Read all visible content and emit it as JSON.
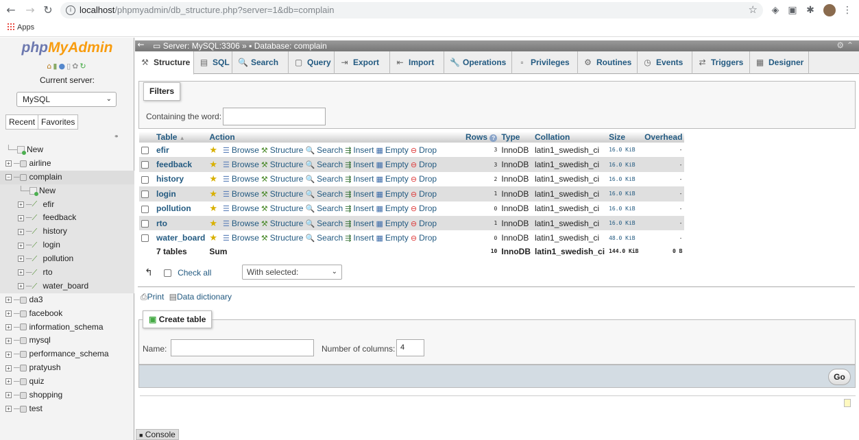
{
  "browser": {
    "url_host": "localhost",
    "url_path": "/phpmyadmin/db_structure.php?server=1&db=complain",
    "apps_label": "Apps"
  },
  "sidebar": {
    "logo_php": "php",
    "logo_myadmin": "MyAdmin",
    "current_server_label": "Current server:",
    "server_select": "MySQL",
    "tabs": [
      "Recent",
      "Favorites"
    ],
    "tree": [
      {
        "label": "New",
        "level": 0,
        "kind": "new"
      },
      {
        "label": "airline",
        "level": 0,
        "kind": "db"
      },
      {
        "label": "complain",
        "level": 0,
        "kind": "db",
        "expanded": true
      },
      {
        "label": "New",
        "level": 1,
        "kind": "new"
      },
      {
        "label": "efir",
        "level": 1,
        "kind": "table"
      },
      {
        "label": "feedback",
        "level": 1,
        "kind": "table"
      },
      {
        "label": "history",
        "level": 1,
        "kind": "table"
      },
      {
        "label": "login",
        "level": 1,
        "kind": "table"
      },
      {
        "label": "pollution",
        "level": 1,
        "kind": "table"
      },
      {
        "label": "rto",
        "level": 1,
        "kind": "table"
      },
      {
        "label": "water_board",
        "level": 1,
        "kind": "table"
      },
      {
        "label": "da3",
        "level": 0,
        "kind": "db"
      },
      {
        "label": "facebook",
        "level": 0,
        "kind": "db"
      },
      {
        "label": "information_schema",
        "level": 0,
        "kind": "db"
      },
      {
        "label": "mysql",
        "level": 0,
        "kind": "db"
      },
      {
        "label": "performance_schema",
        "level": 0,
        "kind": "db"
      },
      {
        "label": "pratyush",
        "level": 0,
        "kind": "db"
      },
      {
        "label": "quiz",
        "level": 0,
        "kind": "db"
      },
      {
        "label": "shopping",
        "level": 0,
        "kind": "db"
      },
      {
        "label": "test",
        "level": 0,
        "kind": "db"
      }
    ]
  },
  "breadcrumb": {
    "server": "Server: MySQL:3306",
    "sep": "»",
    "database": "Database: complain"
  },
  "menu": {
    "tabs": [
      {
        "label": "Structure",
        "icon": "structure-icon",
        "glyph": "⚒"
      },
      {
        "label": "SQL",
        "icon": "sql-icon",
        "glyph": "▤"
      },
      {
        "label": "Search",
        "icon": "search-icon",
        "glyph": "🔍"
      },
      {
        "label": "Query",
        "icon": "query-icon",
        "glyph": "▢"
      },
      {
        "label": "Export",
        "icon": "export-icon",
        "glyph": "⇥"
      },
      {
        "label": "Import",
        "icon": "import-icon",
        "glyph": "⇤"
      },
      {
        "label": "Operations",
        "icon": "wrench-icon",
        "glyph": "🔧"
      },
      {
        "label": "Privileges",
        "icon": "privileges-icon",
        "glyph": "▫"
      },
      {
        "label": "Routines",
        "icon": "routines-icon",
        "glyph": "⚙"
      },
      {
        "label": "Events",
        "icon": "clock-icon",
        "glyph": "◷"
      },
      {
        "label": "Triggers",
        "icon": "triggers-icon",
        "glyph": "⇄"
      },
      {
        "label": "Designer",
        "icon": "designer-icon",
        "glyph": "▦"
      }
    ]
  },
  "filters": {
    "legend": "Filters",
    "containing_label": "Containing the word:",
    "containing_value": ""
  },
  "table": {
    "headers": {
      "table": "Table",
      "sort_arrow": "▲",
      "action": "Action",
      "rows": "Rows",
      "type": "Type",
      "collation": "Collation",
      "size": "Size",
      "overhead": "Overhead"
    },
    "actions": [
      "Browse",
      "Structure",
      "Search",
      "Insert",
      "Empty",
      "Drop"
    ],
    "rows": [
      {
        "name": "efir",
        "rows": "3",
        "type": "InnoDB",
        "collation": "latin1_swedish_ci",
        "size": "16.0 KiB",
        "overhead": "-"
      },
      {
        "name": "feedback",
        "rows": "3",
        "type": "InnoDB",
        "collation": "latin1_swedish_ci",
        "size": "16.0 KiB",
        "overhead": "-"
      },
      {
        "name": "history",
        "rows": "2",
        "type": "InnoDB",
        "collation": "latin1_swedish_ci",
        "size": "16.0 KiB",
        "overhead": "-"
      },
      {
        "name": "login",
        "rows": "1",
        "type": "InnoDB",
        "collation": "latin1_swedish_ci",
        "size": "16.0 KiB",
        "overhead": "-"
      },
      {
        "name": "pollution",
        "rows": "0",
        "type": "InnoDB",
        "collation": "latin1_swedish_ci",
        "size": "16.0 KiB",
        "overhead": "-"
      },
      {
        "name": "rto",
        "rows": "1",
        "type": "InnoDB",
        "collation": "latin1_swedish_ci",
        "size": "16.0 KiB",
        "overhead": "-"
      },
      {
        "name": "water_board",
        "rows": "0",
        "type": "InnoDB",
        "collation": "latin1_swedish_ci",
        "size": "48.0 KiB",
        "overhead": "-"
      }
    ],
    "footer": {
      "count": "7 tables",
      "sum": "Sum",
      "rows": "10",
      "type": "InnoDB",
      "collation": "latin1_swedish_ci",
      "size": "144.0 KiB",
      "overhead": "0 B"
    }
  },
  "bulk": {
    "check_all": "Check all",
    "with_selected": "With selected:"
  },
  "links": {
    "print": "Print",
    "data_dictionary": "Data dictionary"
  },
  "create_table": {
    "legend": "Create table",
    "name_label": "Name:",
    "name_value": "",
    "columns_label": "Number of columns:",
    "columns_value": "4",
    "go": "Go"
  },
  "console": "Console"
}
